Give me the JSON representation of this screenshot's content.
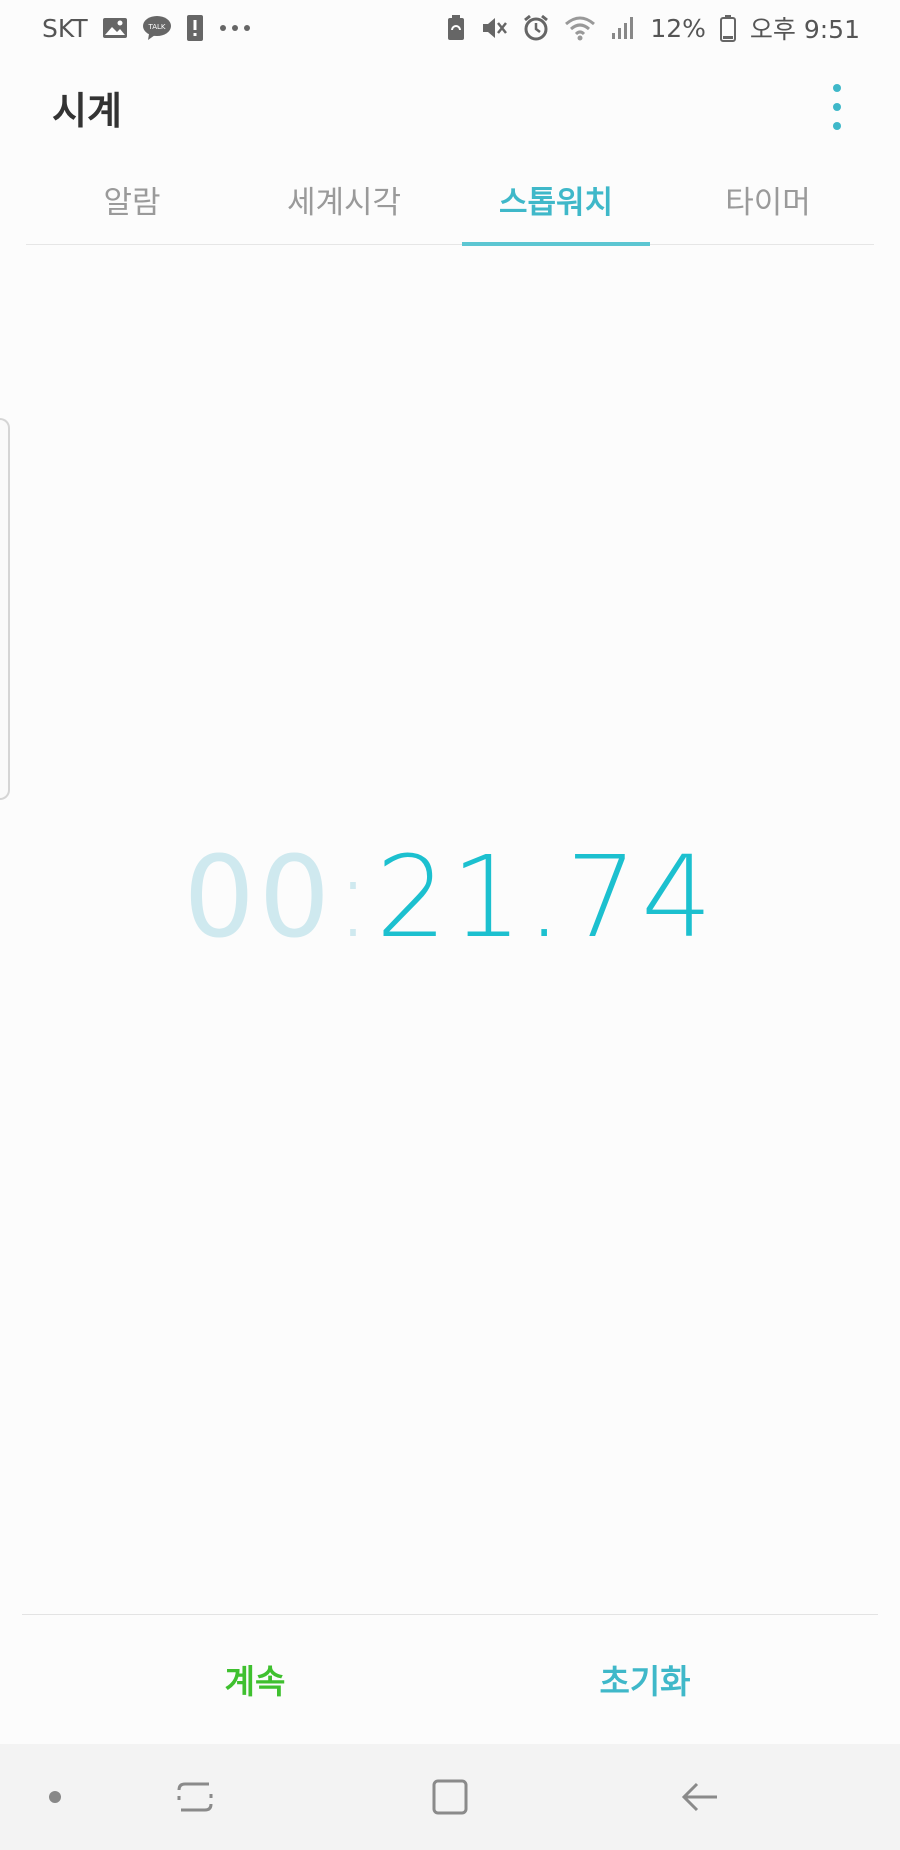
{
  "status_bar": {
    "carrier": "SKT",
    "battery_percent": "12%",
    "time": "오후 9:51",
    "left_icons": [
      "gallery-icon",
      "kakaotalk-icon",
      "alert-icon",
      "more-notifications-icon"
    ],
    "right_icons": [
      "battery-saver-icon",
      "mute-icon",
      "alarm-icon",
      "wifi-icon",
      "signal-icon",
      "battery-icon"
    ]
  },
  "app": {
    "title": "시계",
    "more_icon": "more-vert-icon"
  },
  "tabs": [
    {
      "label": "알람",
      "active": false
    },
    {
      "label": "세계시각",
      "active": false
    },
    {
      "label": "스톱워치",
      "active": true
    },
    {
      "label": "타이머",
      "active": false
    }
  ],
  "stopwatch": {
    "minutes": "00",
    "separator": ":",
    "seconds": "21.74"
  },
  "buttons": {
    "continue": "계속",
    "reset": "초기화"
  },
  "colors": {
    "accent": "#3fb8c9",
    "time": "#1cc0cf",
    "continue": "#3fc02f"
  },
  "navigation": [
    "dot-icon",
    "recent-apps-icon",
    "home-icon",
    "back-icon"
  ]
}
